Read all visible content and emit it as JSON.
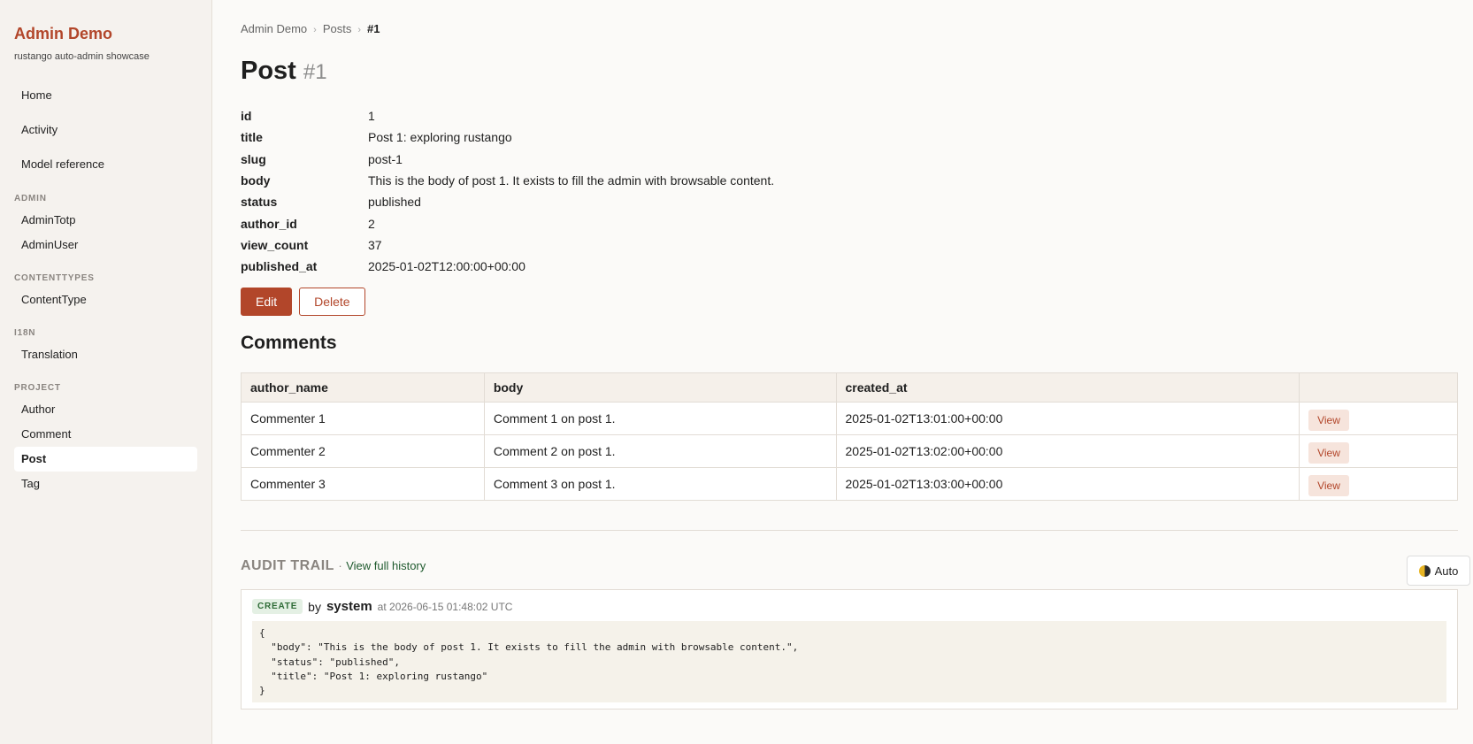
{
  "sidebar": {
    "brand": "Admin Demo",
    "subtitle": "rustango auto-admin showcase",
    "top_items": [
      "Home",
      "Activity",
      "Model reference"
    ],
    "groups": [
      {
        "label": "ADMIN",
        "items": [
          "AdminTotp",
          "AdminUser"
        ]
      },
      {
        "label": "CONTENTTYPES",
        "items": [
          "ContentType"
        ]
      },
      {
        "label": "I18N",
        "items": [
          "Translation"
        ]
      },
      {
        "label": "PROJECT",
        "items": [
          "Author",
          "Comment",
          "Post",
          "Tag"
        ]
      }
    ],
    "active": "Post"
  },
  "breadcrumb": {
    "root": "Admin Demo",
    "section": "Posts",
    "current": "#1",
    "sep": "›"
  },
  "page": {
    "title": "Post",
    "id_label": "#1"
  },
  "fields": [
    {
      "key": "id",
      "value": "1"
    },
    {
      "key": "title",
      "value": "Post 1: exploring rustango"
    },
    {
      "key": "slug",
      "value": "post-1"
    },
    {
      "key": "body",
      "value": "This is the body of post 1. It exists to fill the admin with browsable content."
    },
    {
      "key": "status",
      "value": "published"
    },
    {
      "key": "author_id",
      "value": "2"
    },
    {
      "key": "view_count",
      "value": "37"
    },
    {
      "key": "published_at",
      "value": "2025-01-02T12:00:00+00:00"
    }
  ],
  "actions": {
    "edit": "Edit",
    "delete": "Delete"
  },
  "comments": {
    "title": "Comments",
    "columns": [
      "author_name",
      "body",
      "created_at",
      ""
    ],
    "rows": [
      {
        "author_name": "Commenter 1",
        "body": "Comment 1 on post 1.",
        "created_at": "2025-01-02T13:01:00+00:00",
        "action": "View"
      },
      {
        "author_name": "Commenter 2",
        "body": "Comment 2 on post 1.",
        "created_at": "2025-01-02T13:02:00+00:00",
        "action": "View"
      },
      {
        "author_name": "Commenter 3",
        "body": "Comment 3 on post 1.",
        "created_at": "2025-01-02T13:03:00+00:00",
        "action": "View"
      }
    ]
  },
  "audit": {
    "title": "AUDIT TRAIL",
    "dot": "·",
    "link": "View full history",
    "entry": {
      "action": "CREATE",
      "by": "by",
      "user": "system",
      "at": "at 2026-06-15 01:48:02 UTC",
      "json": "{\n  \"body\": \"This is the body of post 1. It exists to fill the admin with browsable content.\",\n  \"status\": \"published\",\n  \"title\": \"Post 1: exploring rustango\"\n}"
    }
  },
  "theme_toggle": {
    "label": "Auto",
    "icon": "half-moon-icon"
  },
  "colors": {
    "accent": "#b2462a",
    "link": "#1f5a2e",
    "badge_bg": "#e4f0e4"
  }
}
